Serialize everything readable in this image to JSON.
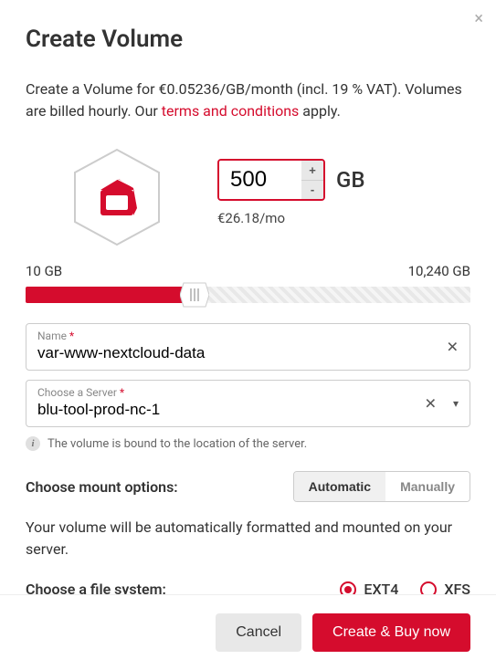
{
  "title": "Create Volume",
  "description": {
    "prefix": "Create a Volume for ",
    "price_rate": "€0.05236/GB/month",
    "vat_note": " (incl. 19 % VAT). Volumes are billed hourly. Our ",
    "terms_link": "terms and conditions",
    "suffix": " apply."
  },
  "size": {
    "value": "500",
    "unit": "GB",
    "price": "€26.18/mo"
  },
  "slider": {
    "min_label": "10 GB",
    "max_label": "10,240 GB"
  },
  "name_field": {
    "label": "Name",
    "value": "var-www-nextcloud-data"
  },
  "server_field": {
    "label": "Choose a Server",
    "value": "blu-tool-prod-nc-1"
  },
  "hint": "The volume is bound to the location of the server.",
  "mount": {
    "label": "Choose mount options:",
    "options": {
      "auto": "Automatic",
      "manual": "Manually"
    },
    "description": "Your volume will be automatically formatted and mounted on your server."
  },
  "fs": {
    "label": "Choose a file system:",
    "options": {
      "ext4": "EXT4",
      "xfs": "XFS"
    }
  },
  "footer": {
    "cancel": "Cancel",
    "submit": "Create & Buy now"
  }
}
